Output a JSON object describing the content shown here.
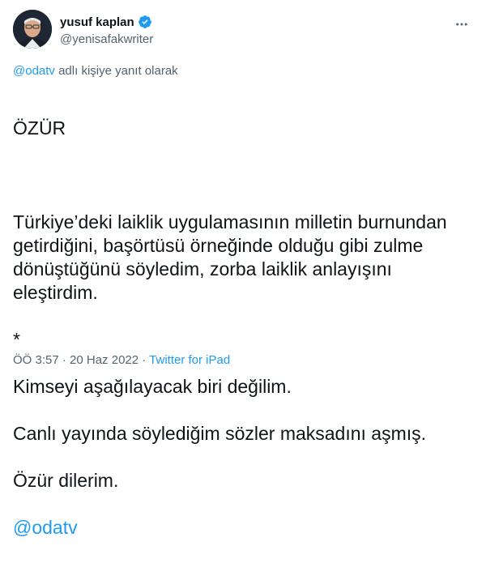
{
  "user": {
    "display_name": "yusuf kaplan",
    "handle": "@yenisafakwriter"
  },
  "reply": {
    "mention": "@odatv",
    "suffix": " adlı kişiye yanıt olarak"
  },
  "tweet": {
    "paragraph_1": "ÖZÜR",
    "paragraph_2": "Türkiye’deki laiklik uygulamasının milletin burnundan getirdiğini, başörtüsü örneğinde olduğu gibi zulme dönüştüğünü söyledim, zorba laiklik anlayışını eleştirdim.",
    "separator": "*",
    "line_1": "Kimseyi aşağılayacak biri değilim.",
    "line_2": "Canlı yayında söylediğim sözler maksadını aşmış.",
    "line_3": "Özür dilerim.",
    "hashtag_mention": "@odatv"
  },
  "meta": {
    "time_date": "ÖÖ 3:57 · 20 Haz 2022 · ",
    "source": "Twitter for iPad"
  },
  "colors": {
    "accent": "#1d9bf0",
    "text": "#0f1419",
    "secondary": "#536471"
  },
  "icons": {
    "verified": "verified-badge-icon",
    "more": "more-options-icon"
  }
}
